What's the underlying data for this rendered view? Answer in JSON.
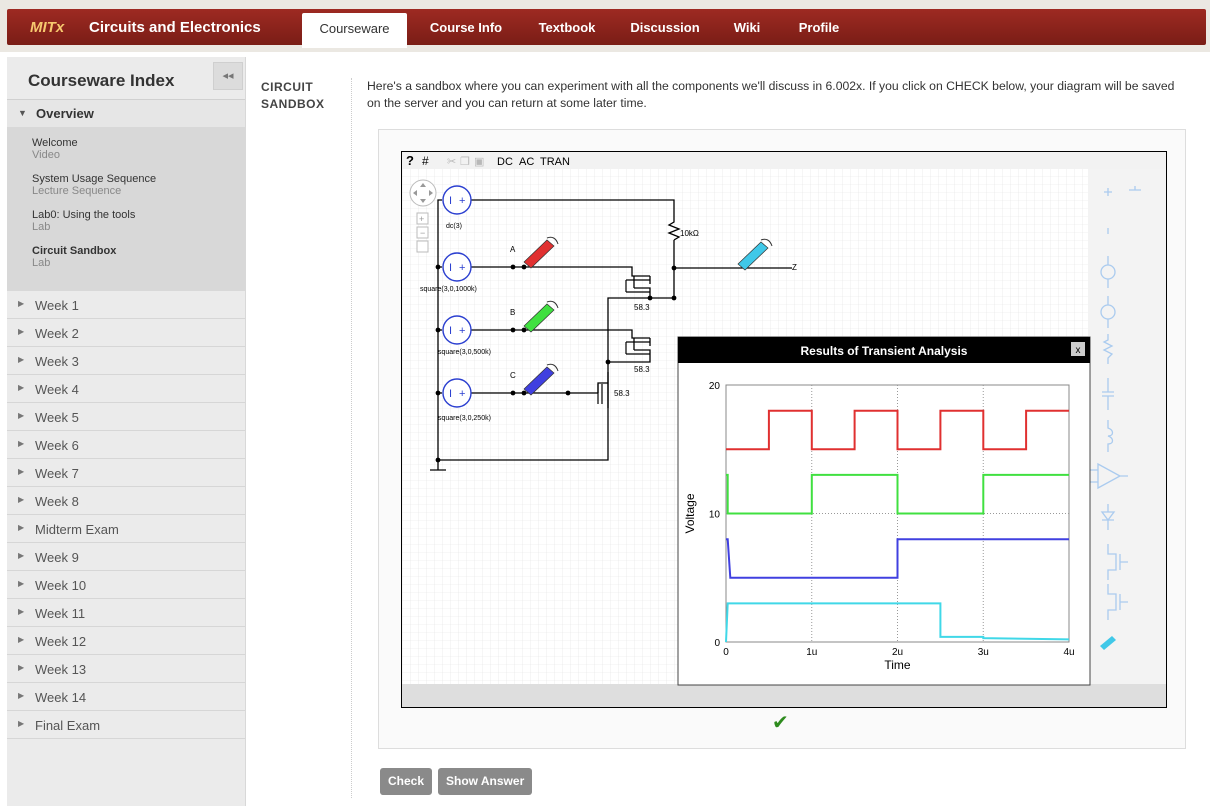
{
  "header": {
    "brand_mitx": "MITx",
    "brand_title": "Circuits and Electronics",
    "tabs": [
      "Courseware",
      "Course Info",
      "Textbook",
      "Discussion",
      "Wiki",
      "Profile"
    ]
  },
  "sidebar": {
    "title": "Courseware Index",
    "collapse_icon": "double-left-icon",
    "overview": {
      "label": "Overview",
      "items": [
        {
          "title": "Welcome",
          "type": "Video"
        },
        {
          "title": "System Usage Sequence",
          "type": "Lecture Sequence"
        },
        {
          "title": "Lab0: Using the tools",
          "type": "Lab"
        },
        {
          "title": "Circuit Sandbox",
          "type": "Lab"
        }
      ]
    },
    "chapters": [
      "Week 1",
      "Week 2",
      "Week 3",
      "Week 4",
      "Week 5",
      "Week 6",
      "Week 7",
      "Week 8",
      "Midterm Exam",
      "Week 9",
      "Week 10",
      "Week 11",
      "Week 12",
      "Week 13",
      "Week 14",
      "Final Exam"
    ]
  },
  "content": {
    "section_label": "CIRCUIT\nSANDBOX",
    "intro": "Here's a sandbox where you can experiment with all the components we'll discuss in 6.002x. If you click on CHECK below, your diagram will be saved on the server and you can return at some later time."
  },
  "toolbar": {
    "help": "?",
    "dc": "DC",
    "ac": "AC",
    "tran": "TRAN"
  },
  "circuit": {
    "sources": [
      "dc(3)",
      "square(3,0,1000k)",
      "square(3,0,500k)",
      "square(3,0,250k)"
    ],
    "node_labels": [
      "A",
      "B",
      "C",
      "Z"
    ],
    "resistor": "10kΩ",
    "mosfet_labels": [
      "58.3",
      "58.3",
      "58.3"
    ],
    "probe_colors": {
      "A": "#e03030",
      "B": "#40e040",
      "C": "#4040e0",
      "Z": "#40c8e8"
    }
  },
  "plot_window": {
    "title": "Results of Transient Analysis",
    "close": "x"
  },
  "chart_data": {
    "type": "line",
    "title": "Results of Transient Analysis",
    "xlabel": "Time",
    "ylabel": "Voltage",
    "xlim": [
      0,
      4
    ],
    "ylim": [
      0,
      20
    ],
    "x_ticks": [
      "0",
      "1u",
      "2u",
      "3u",
      "4u"
    ],
    "y_ticks": [
      "0",
      "10",
      "20"
    ],
    "grid": true,
    "series": [
      {
        "color": "#e03030",
        "x": [
          0,
          0.5,
          0.5,
          1.0,
          1.0,
          1.5,
          1.5,
          2.0,
          2.0,
          2.5,
          2.5,
          3.0,
          3.0,
          3.5,
          3.5,
          4.0
        ],
        "y": [
          15,
          15,
          18,
          18,
          15,
          15,
          18,
          18,
          15,
          15,
          18,
          18,
          15,
          15,
          18,
          18
        ]
      },
      {
        "color": "#40e040",
        "x": [
          0,
          0.02,
          0.02,
          1.0,
          1.0,
          2.0,
          2.0,
          3.0,
          3.0,
          4.0
        ],
        "y": [
          13,
          13,
          10,
          10,
          13,
          13,
          10,
          10,
          13,
          13
        ]
      },
      {
        "color": "#4040e0",
        "x": [
          0,
          0.02,
          0.05,
          2.0,
          2.0,
          4.0
        ],
        "y": [
          8,
          8,
          5,
          5,
          8,
          8
        ]
      },
      {
        "color": "#40d8e8",
        "x": [
          0,
          0.02,
          2.5,
          2.5,
          3.0,
          3.0,
          4.0
        ],
        "y": [
          0,
          3,
          3,
          0.4,
          0.4,
          0.3,
          0.2
        ]
      }
    ]
  },
  "check_mark": "✔",
  "buttons": {
    "check": "Check",
    "show_answer": "Show Answer"
  }
}
